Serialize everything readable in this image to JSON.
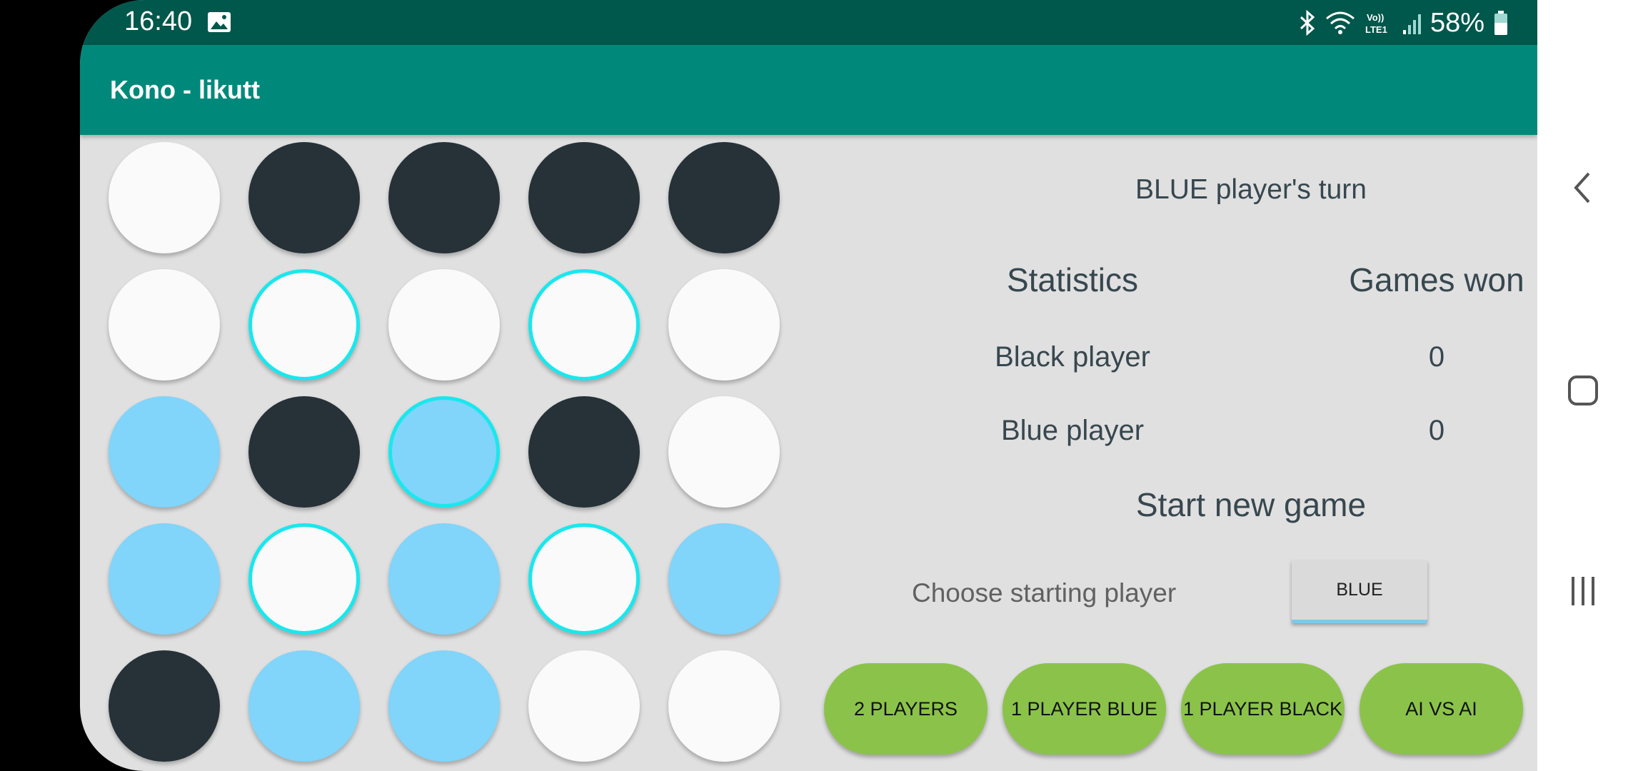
{
  "status_bar": {
    "time": "16:40",
    "battery": "58%",
    "icons": [
      "image-icon",
      "bluetooth-icon",
      "wifi-icon",
      "volte-lte-icon",
      "signal-icon",
      "battery-icon"
    ]
  },
  "app_bar": {
    "title": "Kono - likutt"
  },
  "board": {
    "rows": [
      [
        {
          "color": "white",
          "selected": false
        },
        {
          "color": "black",
          "selected": false
        },
        {
          "color": "black",
          "selected": false
        },
        {
          "color": "black",
          "selected": false
        },
        {
          "color": "black",
          "selected": false
        }
      ],
      [
        {
          "color": "white",
          "selected": false
        },
        {
          "color": "white",
          "selected": true
        },
        {
          "color": "white",
          "selected": false
        },
        {
          "color": "white",
          "selected": true
        },
        {
          "color": "white",
          "selected": false
        }
      ],
      [
        {
          "color": "blue",
          "selected": false
        },
        {
          "color": "black",
          "selected": false
        },
        {
          "color": "blue",
          "selected": true
        },
        {
          "color": "black",
          "selected": false
        },
        {
          "color": "white",
          "selected": false
        }
      ],
      [
        {
          "color": "blue",
          "selected": false
        },
        {
          "color": "white",
          "selected": true
        },
        {
          "color": "blue",
          "selected": false
        },
        {
          "color": "white",
          "selected": true
        },
        {
          "color": "blue",
          "selected": false
        }
      ],
      [
        {
          "color": "black",
          "selected": false
        },
        {
          "color": "blue",
          "selected": false
        },
        {
          "color": "blue",
          "selected": false
        },
        {
          "color": "white",
          "selected": false
        },
        {
          "color": "white",
          "selected": false
        }
      ]
    ]
  },
  "panel": {
    "turn_text": "BLUE player's turn",
    "stats_header": "Statistics",
    "games_won_header": "Games won",
    "black_player_label": "Black player",
    "black_player_wins": "0",
    "blue_player_label": "Blue player",
    "blue_player_wins": "0",
    "start_new_game": "Start new game",
    "choose_starting_label": "Choose starting player",
    "starting_player_value": "BLUE"
  },
  "mode_buttons": {
    "two_players": "2 PLAYERS",
    "one_player_blue": "1 PLAYER BLUE",
    "one_player_black": "1 PLAYER BLACK",
    "ai_vs_ai": "AI VS AI"
  },
  "colors": {
    "statusbar": "#00574b",
    "appbar": "#00897b",
    "black_piece": "#263238",
    "blue_piece": "#81d4fa",
    "white_piece": "#fafafa",
    "selection_ring": "#18e8ee",
    "mode_button": "#8bc34a"
  },
  "nav_bar": {
    "icons": [
      "back-icon",
      "home-icon",
      "recents-icon"
    ]
  }
}
